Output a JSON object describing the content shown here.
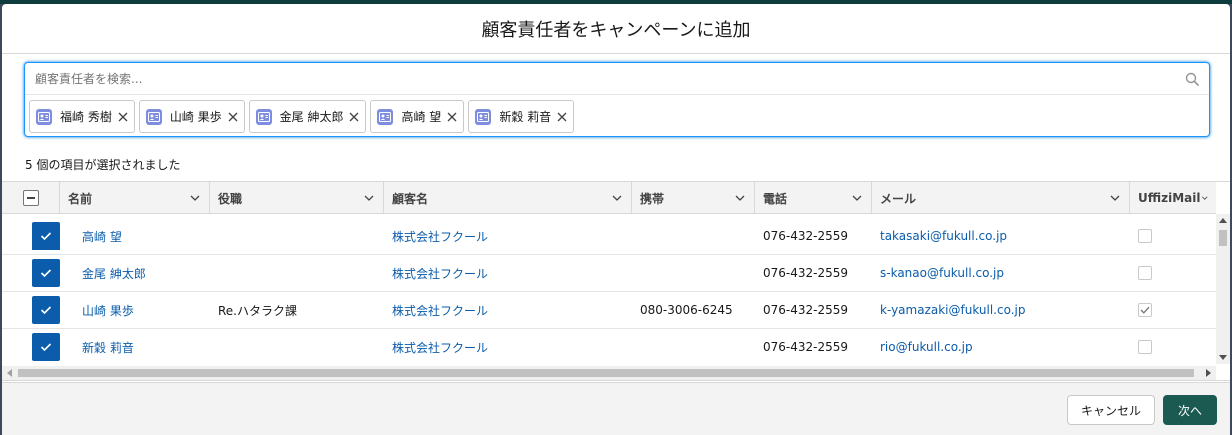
{
  "modal": {
    "title": "顧客責任者をキャンペーンに追加"
  },
  "lookup": {
    "placeholder": "顧客責任者を検索...",
    "search_icon": "search-icon",
    "pills": [
      {
        "label": "福崎 秀樹",
        "icon": "contact-icon"
      },
      {
        "label": "山崎 果歩",
        "icon": "contact-icon"
      },
      {
        "label": "金尾 紳太郎",
        "icon": "contact-icon"
      },
      {
        "label": "高崎 望",
        "icon": "contact-icon"
      },
      {
        "label": "新穀 莉音",
        "icon": "contact-icon"
      }
    ]
  },
  "selection": {
    "count_text": "5 個の項目が選択されました"
  },
  "table": {
    "columns": [
      "名前",
      "役職",
      "顧客名",
      "携帯",
      "電話",
      "メール",
      "UffiziMail"
    ],
    "rows": [
      {
        "checked": true,
        "name": "高崎 望",
        "title": "",
        "account": "株式会社フクール",
        "mobile": "",
        "phone": "076-432-2559",
        "email": "takasaki@fukull.co.jp",
        "uffizi": false
      },
      {
        "checked": true,
        "name": "金尾 紳太郎",
        "title": "",
        "account": "株式会社フクール",
        "mobile": "",
        "phone": "076-432-2559",
        "email": "s-kanao@fukull.co.jp",
        "uffizi": false
      },
      {
        "checked": true,
        "name": "山崎 果歩",
        "title": "Re.ハタラク課",
        "account": "株式会社フクール",
        "mobile": "080-3006-6245",
        "phone": "076-432-2559",
        "email": "k-yamazaki@fukull.co.jp",
        "uffizi": true
      },
      {
        "checked": true,
        "name": "新穀 莉音",
        "title": "",
        "account": "株式会社フクール",
        "mobile": "",
        "phone": "076-432-2559",
        "email": "rio@fukull.co.jp",
        "uffizi": false
      }
    ]
  },
  "footer": {
    "cancel_label": "キャンセル",
    "next_label": "次へ"
  },
  "colors": {
    "brand_button": "#1a5a50",
    "checkbox_selected": "#0b5cab",
    "link": "#0b5cab",
    "focus_border": "#1b96ff",
    "pill_icon": "#7f8de1"
  }
}
